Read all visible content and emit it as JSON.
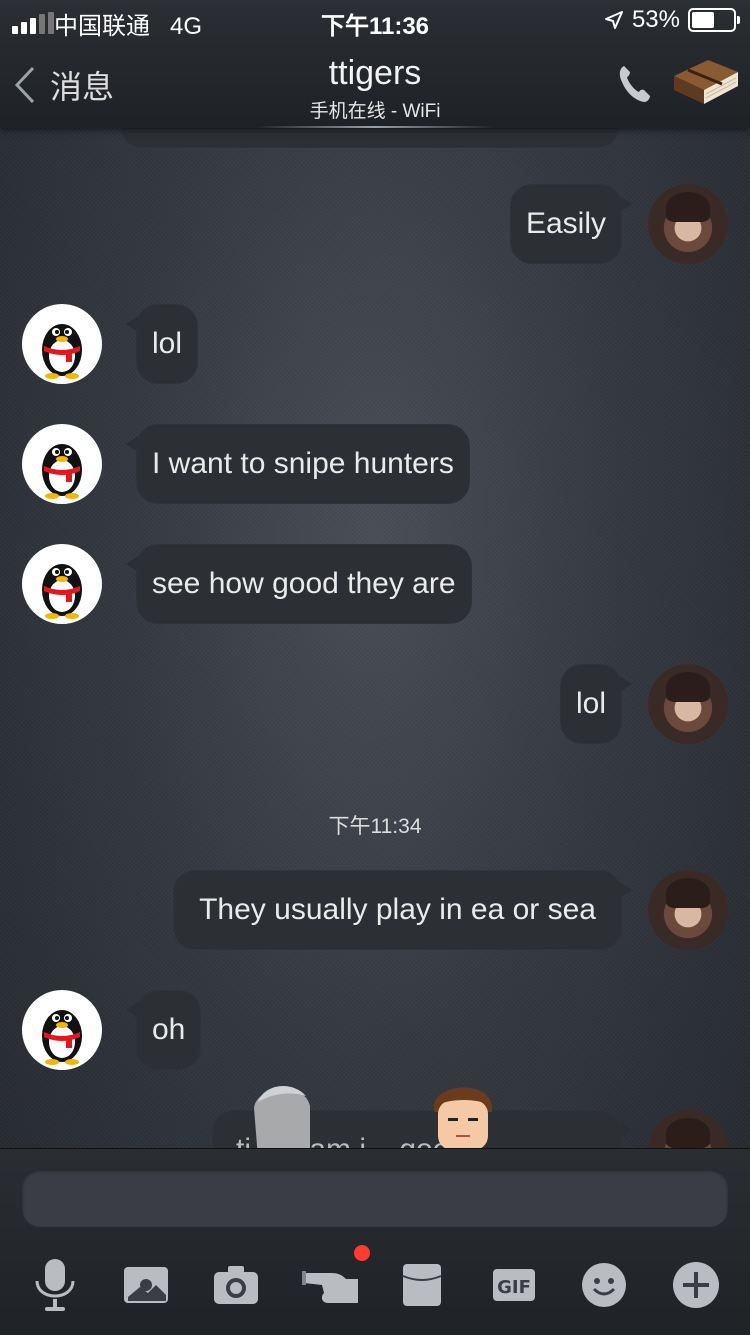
{
  "status_bar": {
    "carrier": "中国联通",
    "network": "4G",
    "time": "下午11:36",
    "battery_percent": "53%",
    "battery_level": 0.53
  },
  "nav": {
    "back_label": "消息",
    "title": "ttigers",
    "subtitle": "手机在线 - WiFi",
    "icons": [
      "phone-icon",
      "book-icon"
    ]
  },
  "messages": [
    {
      "side": "out",
      "text": "Easily"
    },
    {
      "side": "in",
      "text": "lol"
    },
    {
      "side": "in",
      "text": "I want to snipe hunters"
    },
    {
      "side": "in",
      "text": "see how good they are"
    },
    {
      "side": "out",
      "text": "lol"
    },
    {
      "side": "out",
      "text": "They usually play in ea or sea"
    },
    {
      "side": "in",
      "text": "oh"
    },
    {
      "side": "out",
      "text": "ti... team i... good"
    }
  ],
  "timestamp": "下午11:34",
  "input": {
    "placeholder": "",
    "tools": [
      "microphone-icon",
      "image-icon",
      "camera-icon",
      "poke-icon",
      "wallet-icon",
      "gif-icon",
      "emoji-icon",
      "plus-icon"
    ],
    "poke_badge_color": "#ff3b30"
  },
  "colors": {
    "bubble": "#2c3035",
    "accent_badge": "#ff3b30"
  }
}
